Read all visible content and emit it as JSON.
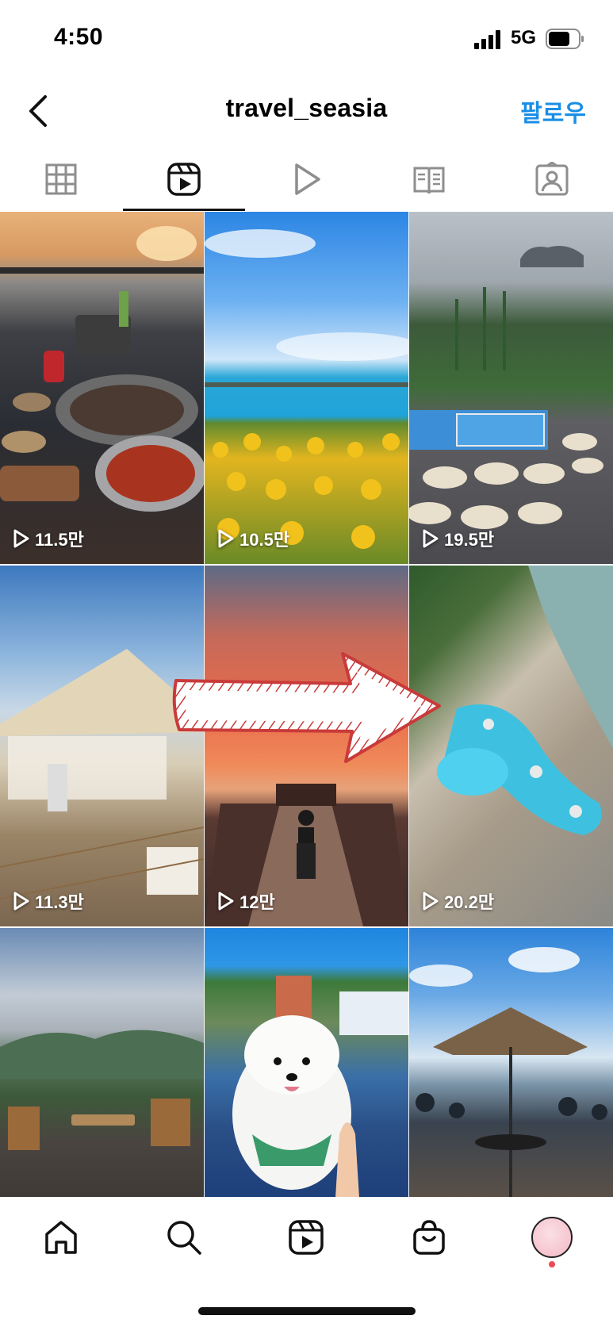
{
  "status_bar": {
    "time": "4:50",
    "network": "5G"
  },
  "header": {
    "username": "travel_seasia",
    "follow_label": "팔로우"
  },
  "tabs": [
    {
      "icon": "grid-icon",
      "active": false
    },
    {
      "icon": "reels-icon",
      "active": true
    },
    {
      "icon": "play-icon",
      "active": false
    },
    {
      "icon": "guide-icon",
      "active": false
    },
    {
      "icon": "tagged-icon",
      "active": false
    }
  ],
  "reels": [
    {
      "views": "11.5만"
    },
    {
      "views": "10.5만"
    },
    {
      "views": "19.5만"
    },
    {
      "views": "11.3만"
    },
    {
      "views": "12만"
    },
    {
      "views": "20.2만"
    },
    {
      "views": ""
    },
    {
      "views": ""
    },
    {
      "views": ""
    }
  ],
  "bottom_nav": [
    "home-icon",
    "search-icon",
    "reels-icon",
    "shop-icon",
    "profile-avatar"
  ],
  "colors": {
    "accent": "#1a8ee6",
    "notification_dot": "#ed4956"
  }
}
